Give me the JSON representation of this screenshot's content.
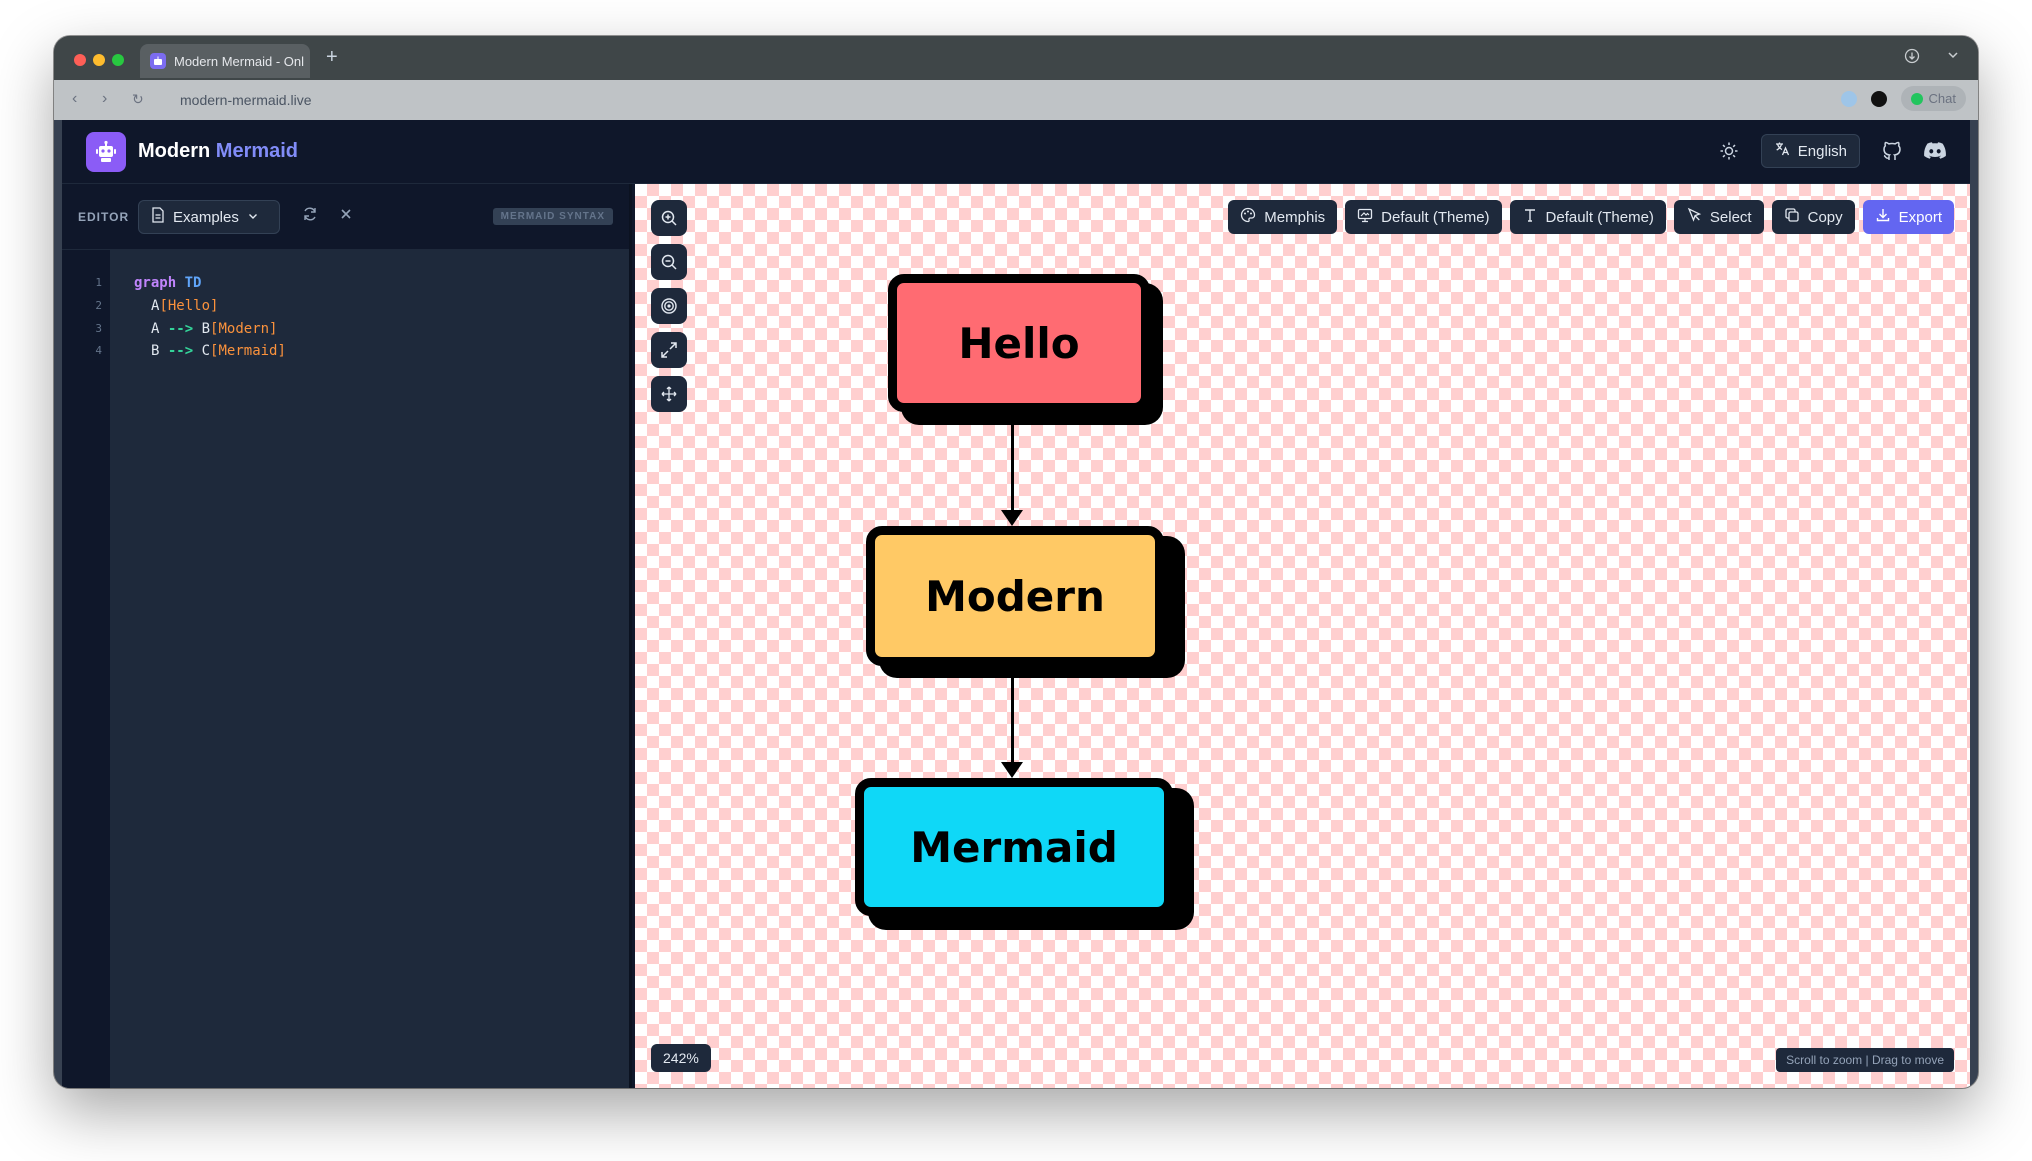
{
  "browser": {
    "tab_title": "Modern Mermaid - Onl",
    "url": "modern-mermaid.live",
    "chat_label": "Chat"
  },
  "app": {
    "brand_primary": "Modern",
    "brand_accent": "Mermaid",
    "language": "English"
  },
  "editor": {
    "label": "EDITOR",
    "examples_label": "Examples",
    "syntax_badge": "MERMAID SYNTAX",
    "line_numbers": [
      "1",
      "2",
      "3",
      "4"
    ],
    "lines": [
      {
        "kw": "graph",
        "dir": "TD"
      },
      {
        "id": "A",
        "label": "[Hello]"
      },
      {
        "from": "A",
        "arrow": "-->",
        "to": "B",
        "label": "[Modern]"
      },
      {
        "from": "B",
        "arrow": "-->",
        "to": "C",
        "label": "[Mermaid]"
      }
    ]
  },
  "canvas": {
    "toolbar": {
      "style_label": "Memphis",
      "theme_label": "Default (Theme)",
      "font_label": "Default (Theme)",
      "select_label": "Select",
      "copy_label": "Copy",
      "export_label": "Export"
    },
    "zoom_level": "242%",
    "hint": "Scroll to zoom | Drag to move"
  },
  "diagram": {
    "nodes": [
      {
        "id": "A",
        "label": "Hello",
        "color": "#ff6b72"
      },
      {
        "id": "B",
        "label": "Modern",
        "color": "#ffc965"
      },
      {
        "id": "C",
        "label": "Mermaid",
        "color": "#0fd8f7"
      }
    ]
  },
  "colors": {
    "accent": "#6366f1",
    "checker": "#ffcfcf",
    "bg_dark": "#0f172a"
  }
}
